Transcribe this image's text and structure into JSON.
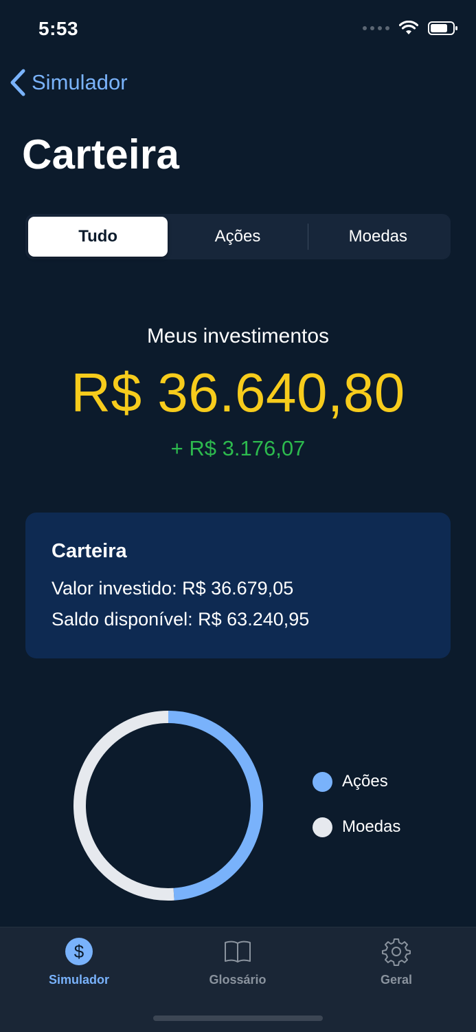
{
  "status_bar": {
    "time": "5:53"
  },
  "nav": {
    "back_label": "Simulador"
  },
  "page": {
    "title": "Carteira"
  },
  "segments": [
    {
      "label": "Tudo",
      "active": true
    },
    {
      "label": "Ações",
      "active": false
    },
    {
      "label": "Moedas",
      "active": false
    }
  ],
  "summary": {
    "label": "Meus investimentos",
    "total": "R$ 36.640,80",
    "change": "+ R$ 3.176,07"
  },
  "card": {
    "title": "Carteira",
    "invested": "Valor investido: R$ 36.679,05",
    "balance": "Saldo disponível: R$ 63.240,95"
  },
  "chart_data": {
    "type": "pie",
    "donut": true,
    "categories": [
      "Ações",
      "Moedas"
    ],
    "values": [
      0.49,
      0.51
    ],
    "colors": [
      "#79b2fb",
      "#e6e9ee"
    ]
  },
  "tabs": [
    {
      "label": "Simulador",
      "icon": "dollar-icon",
      "active": true
    },
    {
      "label": "Glossário",
      "icon": "book-icon",
      "active": false
    },
    {
      "label": "Geral",
      "icon": "gear-icon",
      "active": false
    }
  ],
  "colors": {
    "background": "#0c1b2c",
    "accent": "#79b2fb",
    "total_value": "#f7cc1c",
    "positive_change": "#2dba4e",
    "card": "#0e2a52"
  }
}
